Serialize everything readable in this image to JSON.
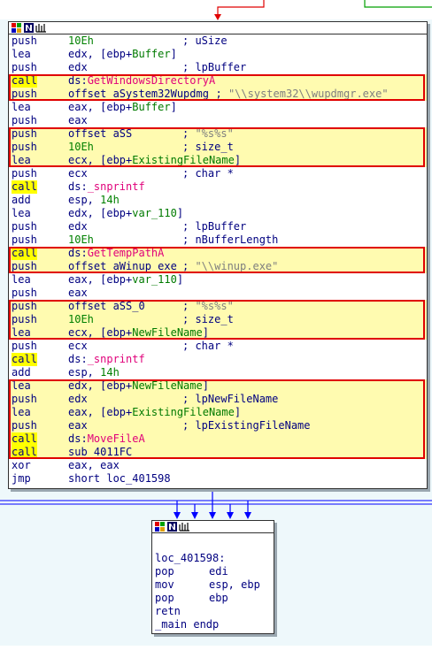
{
  "colors": {
    "background": "#eef8fb",
    "block_border": "#303030",
    "highlight_box": "#e00000",
    "highlight_fill": "#fffbb0",
    "call_highlight": "#ffff00",
    "edge_blue": "#0000ff",
    "edge_red": "#e00000",
    "edge_green": "#00a000"
  },
  "icons": [
    "graph-view-icon",
    "node-edit-icon",
    "table-icon"
  ],
  "main_block": {
    "lines": [
      {
        "mnemonic": "push",
        "operand": "10Eh",
        "comment": "; uSize"
      },
      {
        "mnemonic": "lea",
        "operand": "edx, [ebp+Buffer]",
        "comment": ""
      },
      {
        "mnemonic": "push",
        "operand": "edx",
        "comment": "; lpBuffer"
      },
      {
        "mnemonic": "call",
        "operand": "ds:GetWindowsDirectoryA",
        "comment": ""
      },
      {
        "mnemonic": "push",
        "operand": "offset aSystem32Wupdmg",
        "comment": "; \"\\\\system32\\\\wupdmgr.exe\""
      },
      {
        "mnemonic": "lea",
        "operand": "eax, [ebp+Buffer]",
        "comment": ""
      },
      {
        "mnemonic": "push",
        "operand": "eax",
        "comment": ""
      },
      {
        "mnemonic": "push",
        "operand": "offset aSS",
        "comment": "; \"%s%s\""
      },
      {
        "mnemonic": "push",
        "operand": "10Eh",
        "comment": "; size_t"
      },
      {
        "mnemonic": "lea",
        "operand": "ecx, [ebp+ExistingFileName]",
        "comment": ""
      },
      {
        "mnemonic": "push",
        "operand": "ecx",
        "comment": "; char *"
      },
      {
        "mnemonic": "call",
        "operand": "ds:_snprintf",
        "comment": ""
      },
      {
        "mnemonic": "add",
        "operand": "esp, 14h",
        "comment": ""
      },
      {
        "mnemonic": "lea",
        "operand": "edx, [ebp+var_110]",
        "comment": ""
      },
      {
        "mnemonic": "push",
        "operand": "edx",
        "comment": "; lpBuffer"
      },
      {
        "mnemonic": "push",
        "operand": "10Eh",
        "comment": "; nBufferLength"
      },
      {
        "mnemonic": "call",
        "operand": "ds:GetTempPathA",
        "comment": ""
      },
      {
        "mnemonic": "push",
        "operand": "offset aWinup_exe",
        "comment": "; \"\\\\winup.exe\""
      },
      {
        "mnemonic": "lea",
        "operand": "eax, [ebp+var_110]",
        "comment": ""
      },
      {
        "mnemonic": "push",
        "operand": "eax",
        "comment": ""
      },
      {
        "mnemonic": "push",
        "operand": "offset aSS_0",
        "comment": "; \"%s%s\""
      },
      {
        "mnemonic": "push",
        "operand": "10Eh",
        "comment": "; size_t"
      },
      {
        "mnemonic": "lea",
        "operand": "ecx, [ebp+NewFileName]",
        "comment": ""
      },
      {
        "mnemonic": "push",
        "operand": "ecx",
        "comment": "; char *"
      },
      {
        "mnemonic": "call",
        "operand": "ds:_snprintf",
        "comment": ""
      },
      {
        "mnemonic": "add",
        "operand": "esp, 14h",
        "comment": ""
      },
      {
        "mnemonic": "lea",
        "operand": "edx, [ebp+NewFileName]",
        "comment": ""
      },
      {
        "mnemonic": "push",
        "operand": "edx",
        "comment": "; lpNewFileName"
      },
      {
        "mnemonic": "lea",
        "operand": "eax, [ebp+ExistingFileName]",
        "comment": ""
      },
      {
        "mnemonic": "push",
        "operand": "eax",
        "comment": "; lpExistingFileName"
      },
      {
        "mnemonic": "call",
        "operand": "ds:MoveFileA",
        "comment": ""
      },
      {
        "mnemonic": "call",
        "operand": "sub_4011FC",
        "comment": ""
      },
      {
        "mnemonic": "xor",
        "operand": "eax, eax",
        "comment": ""
      },
      {
        "mnemonic": "jmp",
        "operand": "short loc_401598",
        "comment": ""
      }
    ]
  },
  "exit_block": {
    "label": "loc_401598:",
    "lines": [
      {
        "mnemonic": "pop",
        "operand": "edi"
      },
      {
        "mnemonic": "mov",
        "operand": "esp, ebp"
      },
      {
        "mnemonic": "pop",
        "operand": "ebp"
      },
      {
        "mnemonic": "retn",
        "operand": ""
      }
    ],
    "end_line": "_main endp"
  }
}
